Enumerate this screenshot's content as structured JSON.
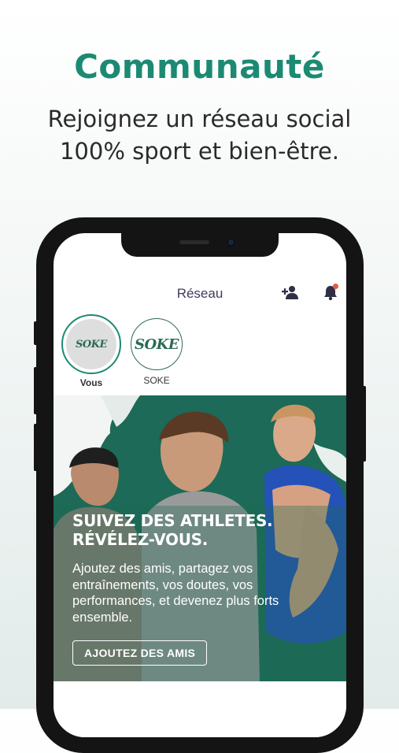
{
  "hero": {
    "title": "Communauté",
    "subtitle_line1": "Rejoignez un réseau social",
    "subtitle_line2": "100% sport et bien-être."
  },
  "app": {
    "nav_title": "Réseau",
    "icons": {
      "add_friend": "add-user-icon",
      "notifications": "bell-icon"
    },
    "stories": [
      {
        "label": "Vous",
        "logo": "SOKE"
      },
      {
        "label": "SOKE",
        "logo": "SOKE"
      }
    ],
    "banner": {
      "headline_line1": "SUIVEZ DES ATHLETES.",
      "headline_line2": "RÉVÉLEZ-VOUS.",
      "body": "Ajoutez des amis, partagez vos entraînements, vos doutes, vos performances, et devenez plus forts ensemble.",
      "cta": "AJOUTEZ DES AMIS"
    }
  },
  "colors": {
    "brand_green": "#1c8a72",
    "banner_green": "#1c6a57",
    "notification_dot": "#e55b3c"
  }
}
